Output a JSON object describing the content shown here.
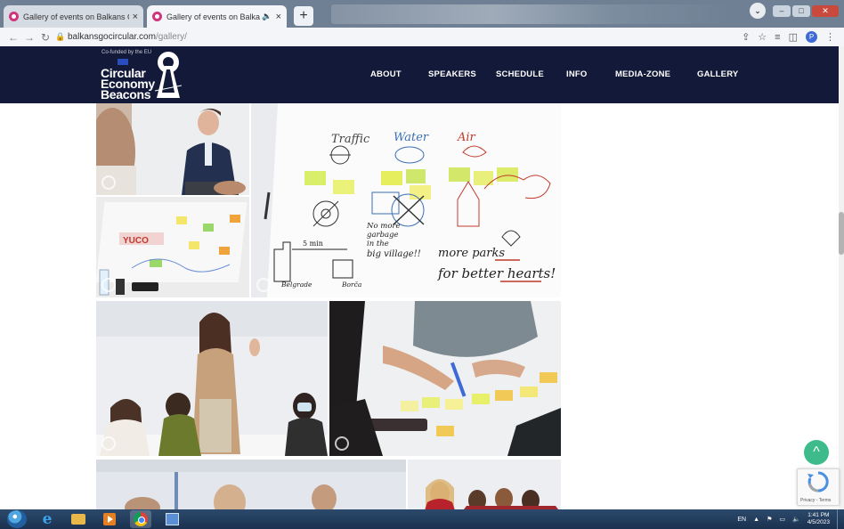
{
  "browser": {
    "tabs": [
      {
        "title": "Gallery of events on Balkans Go",
        "active": false
      },
      {
        "title": "Gallery of events on Balkans",
        "active": true
      }
    ],
    "new_tab": "+",
    "url_host": "balkansgocircular.com",
    "url_path": "/gallery/",
    "window_controls": [
      "–",
      "□",
      "✕"
    ]
  },
  "site": {
    "logo": {
      "line1": "Circular",
      "line2": "Economy",
      "line3": "Beacons",
      "eu_text": "Co-funded by the EU"
    },
    "nav": [
      {
        "label": "ABOUT"
      },
      {
        "label": "SPEAKERS"
      },
      {
        "label": "SCHEDULE"
      },
      {
        "label": "INFO"
      },
      {
        "label": "MEDIA-ZONE"
      },
      {
        "label": "GALLERY"
      }
    ]
  },
  "whiteboard": {
    "headings": [
      "Traffic",
      "Water",
      "Air"
    ],
    "notes": [
      "No more",
      "garbage",
      "in the",
      "big village!!"
    ],
    "slogan1": "more parks",
    "slogan2": "for better hearts!",
    "places": [
      "Belgrade",
      "Borča"
    ],
    "distance": "5 min"
  },
  "widgets": {
    "back_to_top": "^",
    "recaptcha": "Privacy - Terms"
  },
  "taskbar": {
    "lang": "EN",
    "time": "1:41 PM",
    "date": "4/5/2023"
  },
  "colors": {
    "header_bg": "#131938",
    "accent_green": "#3dbb8b",
    "favicon": "#d0357b"
  }
}
